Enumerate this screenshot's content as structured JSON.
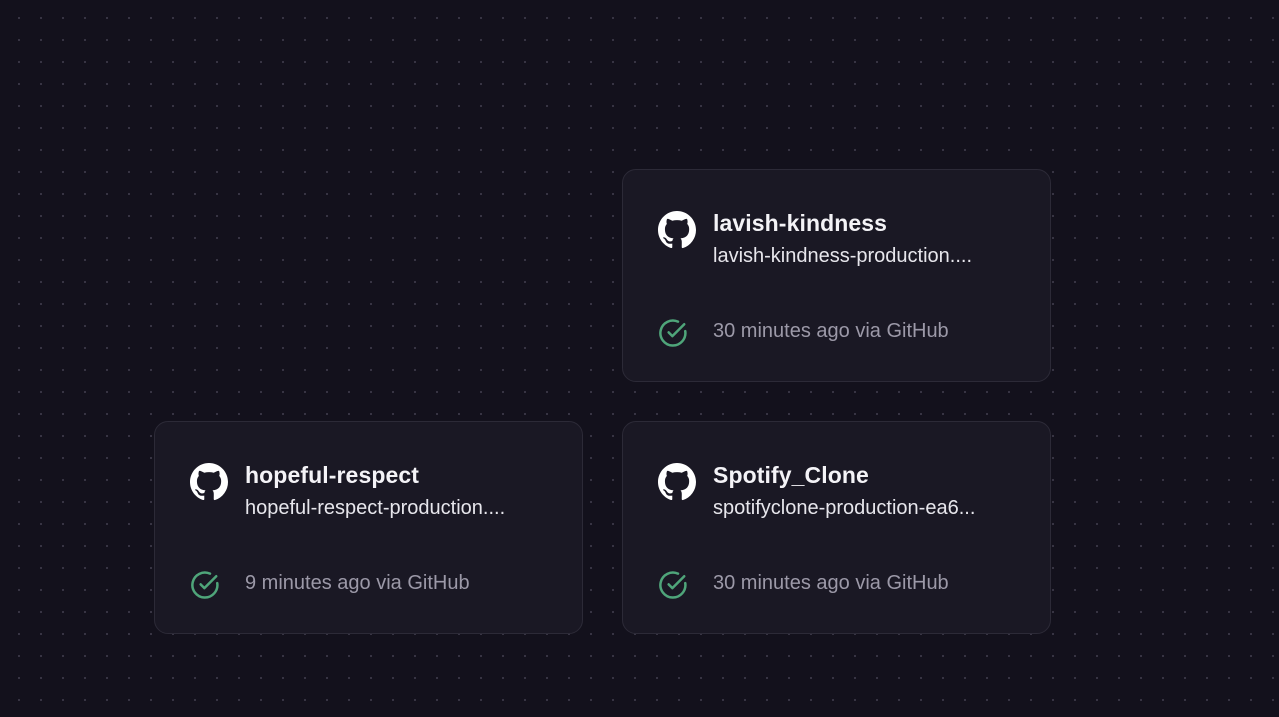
{
  "theme": {
    "background": "#13111c",
    "card_background": "#1a1824",
    "card_border": "#2c2a37",
    "success_color": "#4fa57a",
    "title_color": "#f4f3f7",
    "muted_color": "#9c99a8"
  },
  "services": [
    {
      "name": "lavish-kindness",
      "domain": "lavish-kindness-production....",
      "source_icon": "github-icon",
      "status_icon": "check-circle-icon",
      "status_text": "30 minutes ago via GitHub"
    },
    {
      "name": "hopeful-respect",
      "domain": "hopeful-respect-production....",
      "source_icon": "github-icon",
      "status_icon": "check-circle-icon",
      "status_text": "9 minutes ago via GitHub"
    },
    {
      "name": "Spotify_Clone",
      "domain": "spotifyclone-production-ea6...",
      "source_icon": "github-icon",
      "status_icon": "check-circle-icon",
      "status_text": "30 minutes ago via GitHub"
    }
  ]
}
